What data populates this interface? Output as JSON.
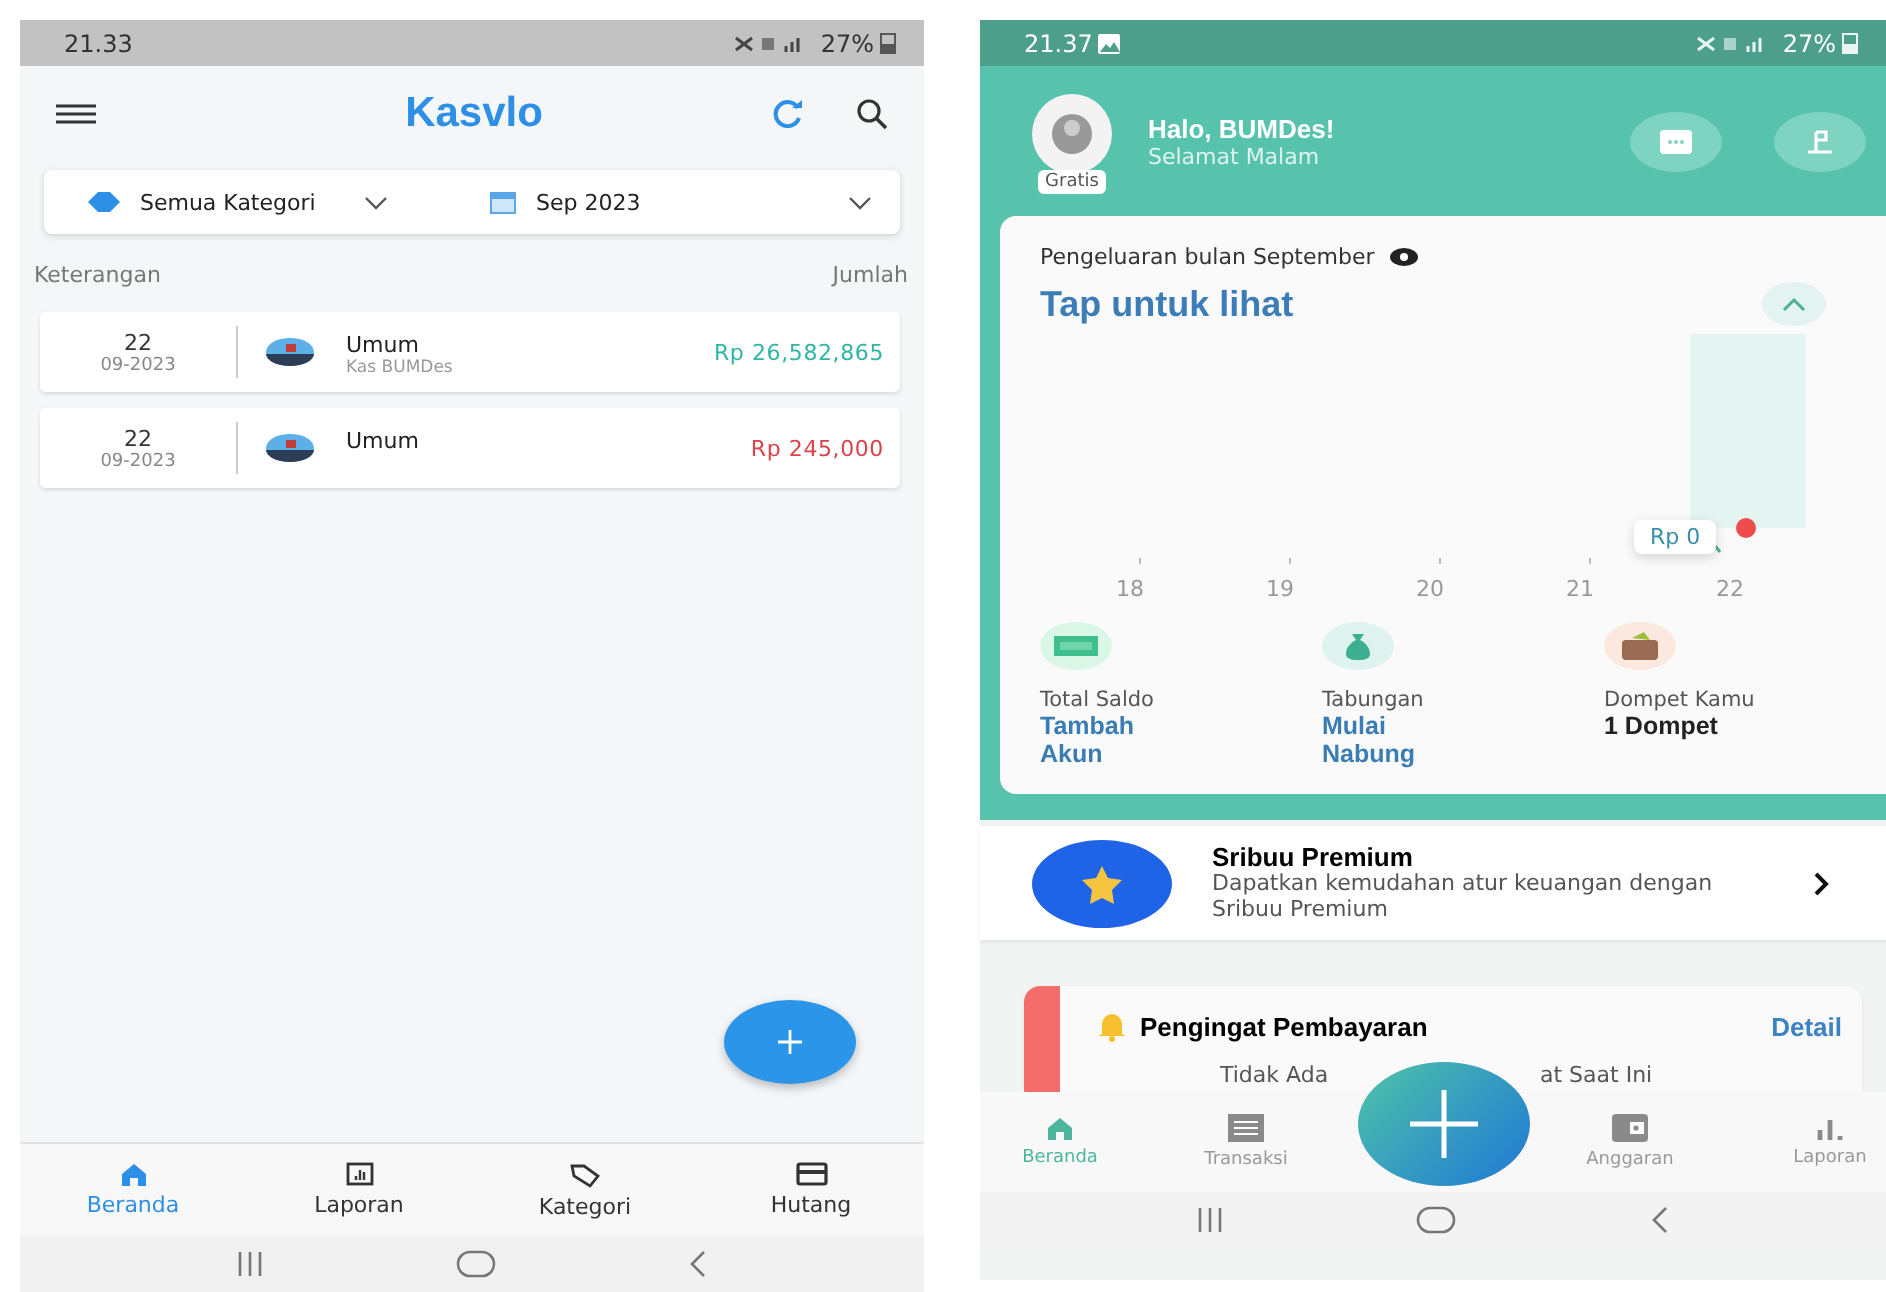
{
  "left_phone": {
    "status_bar": {
      "time": "21.33",
      "battery": "27%"
    },
    "app_bar": {
      "logo": "Kasvlo"
    },
    "filters": {
      "category": "Semua Kategori",
      "period": "Sep 2023"
    },
    "list_header": {
      "left": "Keterangan",
      "right": "Jumlah"
    },
    "transactions": [
      {
        "day": "22",
        "month": "09-2023",
        "category": "Umum",
        "account": "Kas BUMDes",
        "amount": "Rp 26,582,865",
        "kind": "income"
      },
      {
        "day": "22",
        "month": "09-2023",
        "category": "Umum",
        "amount": "Rp 245,000",
        "kind": "expense"
      }
    ],
    "nav": [
      {
        "label": "Beranda",
        "selected": true
      },
      {
        "label": "Laporan",
        "selected": false
      },
      {
        "label": "Kategori",
        "selected": false
      },
      {
        "label": "Hutang",
        "selected": false
      }
    ]
  },
  "right_phone": {
    "status_bar": {
      "time": "21.37",
      "battery": "27%"
    },
    "profile": {
      "badge": "Gratis",
      "greeting": "Halo, BUMDes!",
      "subtitle": "Selamat Malam"
    },
    "expense_card": {
      "title": "Pengeluaran bulan September",
      "value": "Tap untuk lihat",
      "tooltip": "Rp 0",
      "x_labels": [
        "18",
        "19",
        "20",
        "21",
        "22"
      ],
      "stats": [
        {
          "label": "Total Saldo",
          "value": "Tambah Akun",
          "kind": "link"
        },
        {
          "label": "Tabungan",
          "value": "Mulai Nabung",
          "kind": "link"
        },
        {
          "label": "Dompet Kamu",
          "value": "1 Dompet",
          "kind": "plain"
        }
      ]
    },
    "premium": {
      "title": "Sribuu Premium",
      "description": "Dapatkan kemudahan atur keuangan dengan Sribuu Premium"
    },
    "reminder": {
      "title": "Pengingat Pembayaran",
      "link": "Detail",
      "message_start": "Tidak Ada",
      "message_end": "at Saat Ini"
    },
    "nav": [
      {
        "label": "Beranda",
        "selected": true
      },
      {
        "label": "Transaksi",
        "selected": false
      },
      {
        "label": "Anggaran",
        "selected": false
      },
      {
        "label": "Laporan",
        "selected": false
      }
    ]
  }
}
